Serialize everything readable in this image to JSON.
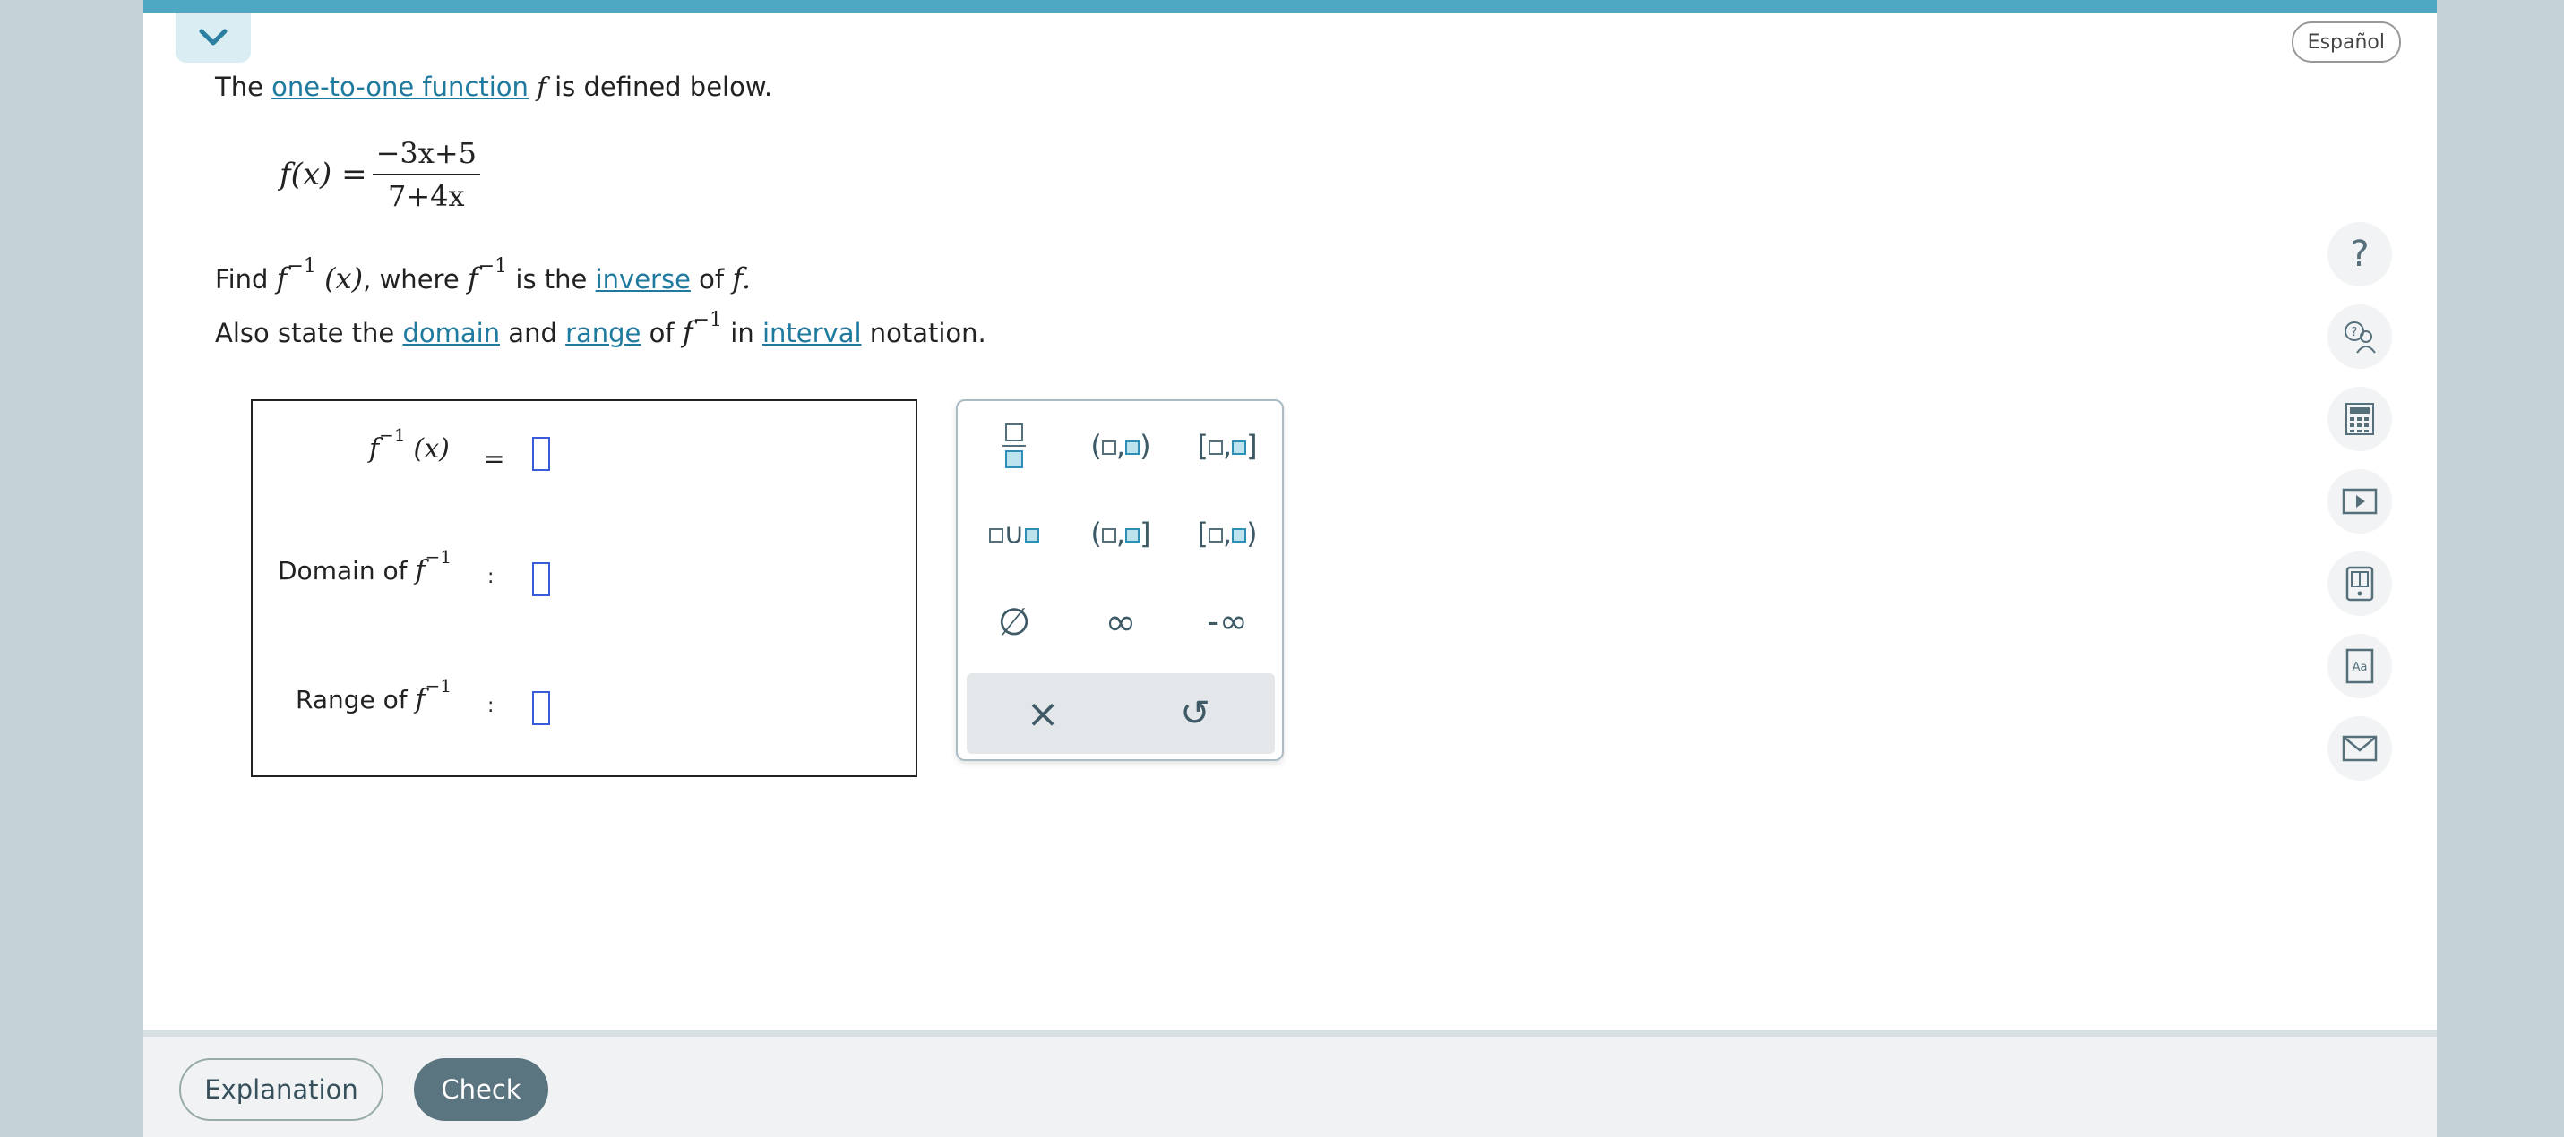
{
  "header": {
    "language_button": "Español"
  },
  "problem": {
    "intro_the": "The",
    "intro_link": "one-to-one function",
    "intro_var": "f",
    "intro_rest": "is defined below.",
    "definition_lhs": "f(x) =",
    "definition_numerator": "−3x+5",
    "definition_denominator": "7+4x",
    "find_word": "Find",
    "find_f": "f",
    "find_sup": "−1",
    "find_arg": "(x)",
    "find_where": ", where",
    "find_f2": "f",
    "find_sup2": "−1",
    "find_is_the": "is the",
    "find_link": "inverse",
    "find_of": "of",
    "find_f3": "f.",
    "also_text": "Also state the",
    "also_link_domain": "domain",
    "also_and": "and",
    "also_link_range": "range",
    "also_of": "of",
    "also_f": "f",
    "also_sup": "−1",
    "also_in": "in",
    "also_link_interval": "interval",
    "also_notation": "notation."
  },
  "answer": {
    "row1_f": "f",
    "row1_sup": "−1",
    "row1_arg": "(x)",
    "row1_eq": "=",
    "row2_label": "Domain of",
    "row2_f": "f",
    "row2_sup": "−1",
    "row2_colon": ":",
    "row3_label": "Range of",
    "row3_f": "f",
    "row3_sup": "−1",
    "row3_colon": ":"
  },
  "palette": {
    "union_symbol": "∪",
    "empty_set": "∅",
    "infinity": "∞",
    "neg_infinity": "-∞",
    "clear": "×",
    "undo": "↺"
  },
  "footer": {
    "explanation": "Explanation",
    "check": "Check"
  },
  "colors": {
    "accent": "#4ea7c3",
    "link": "#1e7a9e",
    "check_button": "#5a7480",
    "slot_border": "#3a5bd9"
  }
}
